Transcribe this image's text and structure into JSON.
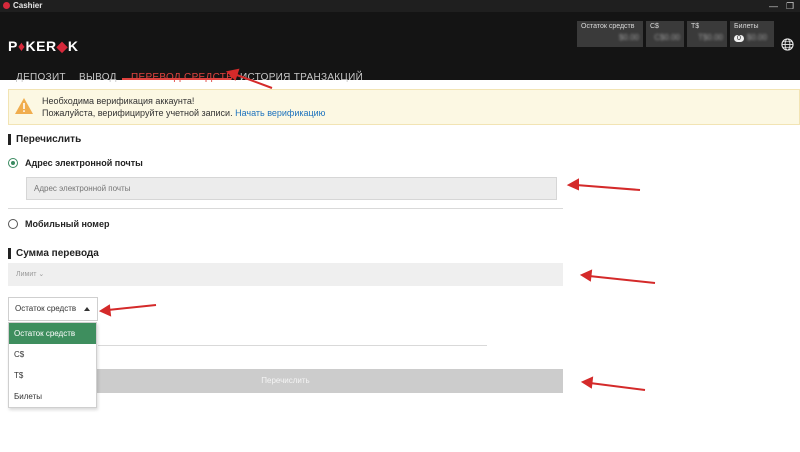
{
  "window": {
    "title": "Cashier"
  },
  "header": {
    "logo": {
      "left": "P",
      "suit": "♦",
      "middle": "KER",
      "suit2": "◆",
      "right": "K"
    },
    "balances": [
      {
        "label": "Остаток средств",
        "value": "$0.00"
      },
      {
        "label": "C$",
        "value": "C$0.00"
      },
      {
        "label": "T$",
        "value": "T$0.00"
      },
      {
        "label": "Билеты",
        "badge": "0",
        "value": "$0.00"
      }
    ]
  },
  "tabs": [
    {
      "label": "ДЕПОЗИТ"
    },
    {
      "label": "ВЫВОД"
    },
    {
      "label": "ПЕРЕВОД СРЕДСТВ"
    },
    {
      "label": "ИСТОРИЯ ТРАНЗАКЦИЙ"
    }
  ],
  "alert": {
    "line1": "Необходима верификация аккаунта!",
    "line2": "Пожалуйста, верифицируйте учетной записи.",
    "link": "Начать верификацию"
  },
  "transfer": {
    "title": "Перечислить",
    "email_option": "Адрес электронной почты",
    "email_placeholder": "Адрес электронной почты",
    "mobile_option": "Мобильный номер"
  },
  "amount": {
    "title": "Сумма перевода",
    "limit_label": "Лимит",
    "select_value": "Остаток средств",
    "options": [
      "Остаток средств",
      "C$",
      "T$",
      "Билеты"
    ],
    "submit_label": "Перечислить"
  },
  "colors": {
    "accent": "#e0433f",
    "header_bg": "#141414",
    "selected_option": "#3e8e5e",
    "link": "#1e73be",
    "annotation_arrow": "#d42a2a"
  }
}
